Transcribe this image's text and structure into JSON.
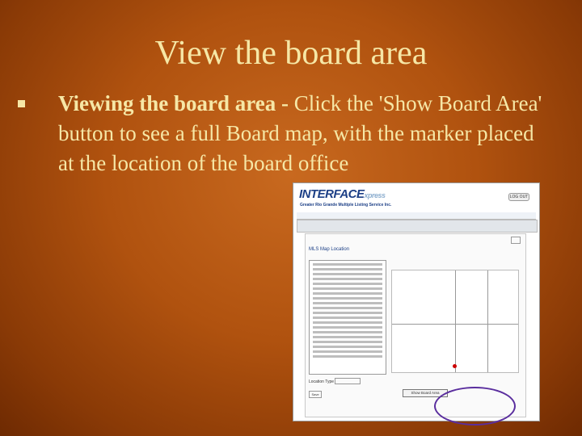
{
  "slide": {
    "title": "View the board area",
    "bullet_bold": "Viewing the board area -",
    "bullet_text": " Click the 'Show Board Area' button to see a full Board map, with the marker placed at the location of the board office"
  },
  "screenshot": {
    "logo": "INTERFACE",
    "logo_small": "xpress",
    "subtitle": "Greater Rio Grande Multiple Listing Service Inc.",
    "logout": "LOG OUT",
    "save": "Save",
    "show_board_area": "Show Board Area",
    "location_label": "Location Type",
    "map_title": "MLS Map Location"
  }
}
